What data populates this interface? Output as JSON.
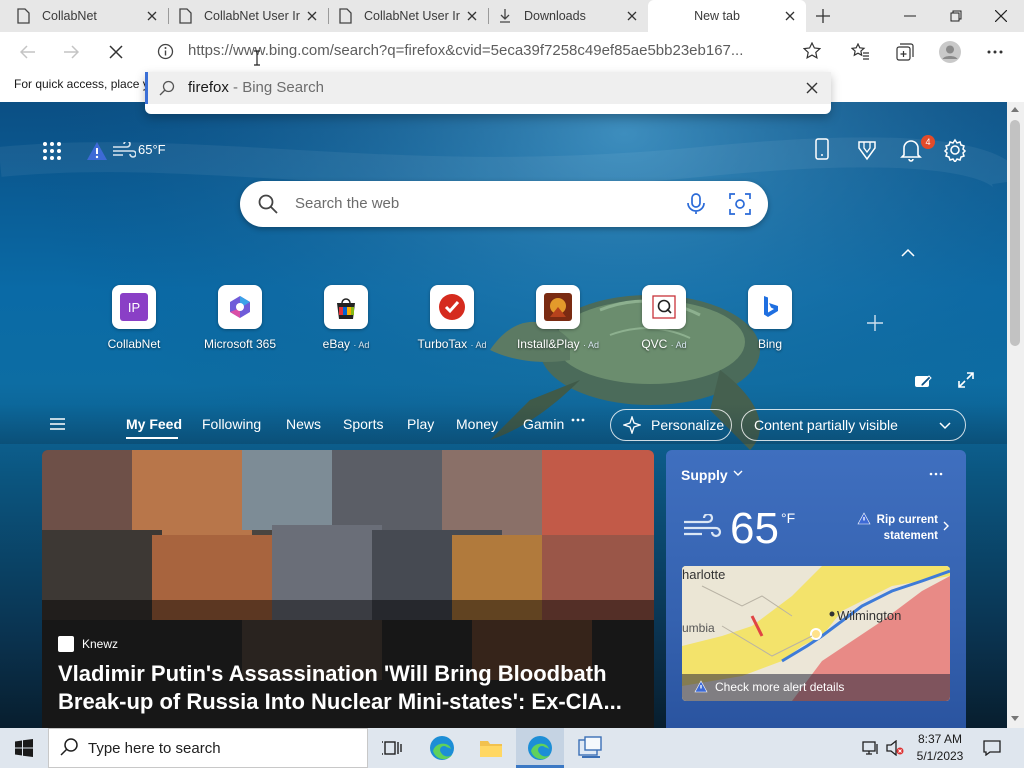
{
  "tabs": [
    {
      "label": "CollabNet",
      "icon": "document-icon"
    },
    {
      "label": "CollabNet User Ir",
      "icon": "document-icon"
    },
    {
      "label": "CollabNet User Ir",
      "icon": "document-icon"
    },
    {
      "label": "Downloads",
      "icon": "download-icon"
    },
    {
      "label": "New tab",
      "icon": "none",
      "active": true
    }
  ],
  "address": {
    "url": "https://www.bing.com/search?q=firefox&cvid=5eca39f7258c49ef85ae5bb23eb167..."
  },
  "suggestion": {
    "query": "firefox",
    "suffix": " - Bing Search"
  },
  "favorites_hint": "For quick access, place y",
  "weather_mini": {
    "temp": "65°F"
  },
  "notifications": {
    "count": "4"
  },
  "search": {
    "placeholder": "Search the web"
  },
  "quick_links": [
    {
      "label": "CollabNet",
      "ad": ""
    },
    {
      "label": "Microsoft 365",
      "ad": ""
    },
    {
      "label": "eBay",
      "ad": "· Ad"
    },
    {
      "label": "TurboTax",
      "ad": "· Ad"
    },
    {
      "label": "Install&Play",
      "ad": "· Ad"
    },
    {
      "label": "QVC",
      "ad": "· Ad"
    },
    {
      "label": "Bing",
      "ad": ""
    }
  ],
  "feed_nav": {
    "items": [
      "My Feed",
      "Following",
      "News",
      "Sports",
      "Play",
      "Money",
      "Gamin"
    ],
    "personalize": "Personalize",
    "content_visibility": "Content partially visible"
  },
  "hero": {
    "source": "Knewz",
    "title": "Vladimir Putin's Assassination 'Will Bring Bloodbath\nBreak-up of Russia Into Nuclear Mini-states': Ex-CIA..."
  },
  "weather_card": {
    "location": "Supply",
    "temp": "65",
    "unit": "°F",
    "alert": "Rip current statement",
    "map_labels": [
      "harlotte",
      "Wilmington",
      "umbia"
    ],
    "more": "Check more alert details"
  },
  "taskbar": {
    "search_placeholder": "Type here to search",
    "time": "8:37 AM",
    "date": "5/1/2023"
  },
  "colors": {
    "accent": "#3b6fd6",
    "notif": "#e34b2a",
    "card": "#3562b0"
  }
}
